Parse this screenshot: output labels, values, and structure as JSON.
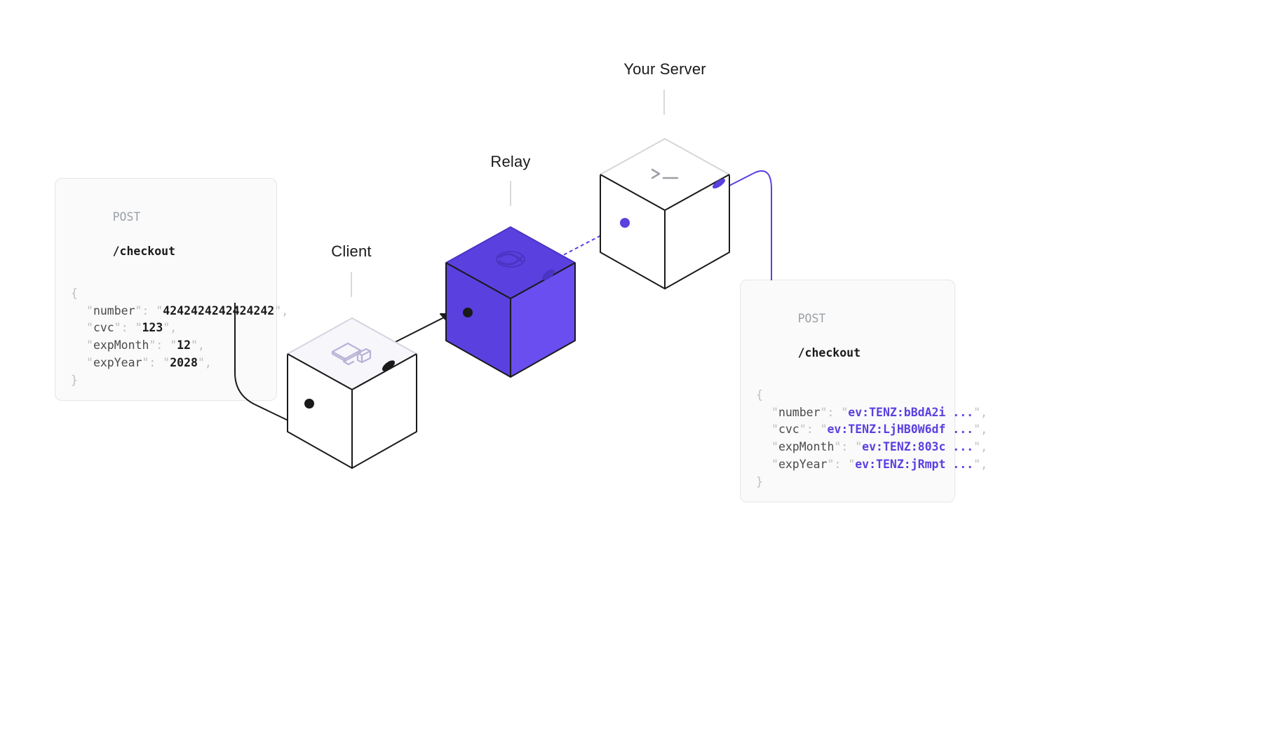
{
  "labels": {
    "client": "Client",
    "relay": "Relay",
    "server": "Your Server"
  },
  "leftCard": {
    "method": "POST",
    "path": "/checkout",
    "fields": [
      {
        "key": "number",
        "value": "4242424242424242"
      },
      {
        "key": "cvc",
        "value": "123"
      },
      {
        "key": "expMonth",
        "value": "12"
      },
      {
        "key": "expYear",
        "value": "2028"
      }
    ]
  },
  "rightCard": {
    "method": "POST",
    "path": "/checkout",
    "fields": [
      {
        "key": "number",
        "value": "ev:TENZ:bBdA2i ..."
      },
      {
        "key": "cvc",
        "value": "ev:TENZ:LjHB0W6df ..."
      },
      {
        "key": "expMonth",
        "value": "ev:TENZ:803c ..."
      },
      {
        "key": "expYear",
        "value": "ev:TENZ:jRmpt ..."
      }
    ]
  },
  "colors": {
    "accent": "#5b40e0",
    "cardBg": "#fafafa",
    "cardBorder": "#e6e6e6",
    "lineDark": "#1a1a1a",
    "lineLight": "#d9d9d9"
  }
}
